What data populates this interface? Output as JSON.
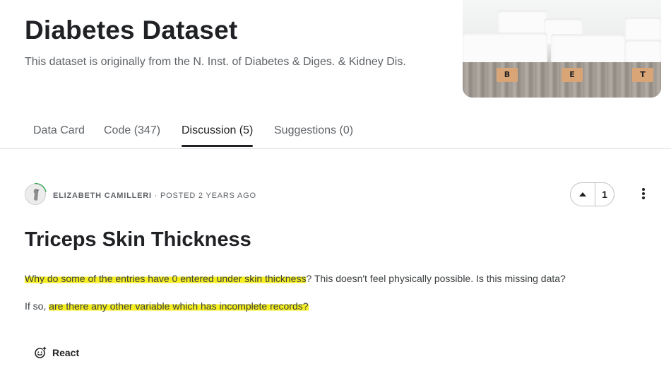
{
  "header": {
    "title": "Diabetes Dataset",
    "subtitle": "This dataset is originally from the N. Inst. of Diabetes & Diges. & Kidney Dis.",
    "image_tiles": [
      "B",
      "E",
      "T"
    ]
  },
  "tabs": [
    {
      "label": "Data Card"
    },
    {
      "label": "Code (347)"
    },
    {
      "label": "Discussion (5)",
      "active": true
    },
    {
      "label": "Suggestions (0)"
    }
  ],
  "post": {
    "author": "ELIZABETH CAMILLERI",
    "separator": "·",
    "posted": "POSTED 2 YEARS AGO",
    "votes": "1",
    "title": "Triceps Skin Thickness",
    "p1_highlight": "Why do some of the entries have 0 entered under skin thickness",
    "p1_rest": "? This doesn't feel physically possible. Is this missing data?",
    "p2_start": "If so, ",
    "p2_highlight": "are there any other variable which has incomplete records?",
    "react_label": "React"
  },
  "colors": {
    "highlight": "#f5f01d",
    "active_tab_underline": "#202124",
    "avatar_ring": "#20a847"
  }
}
